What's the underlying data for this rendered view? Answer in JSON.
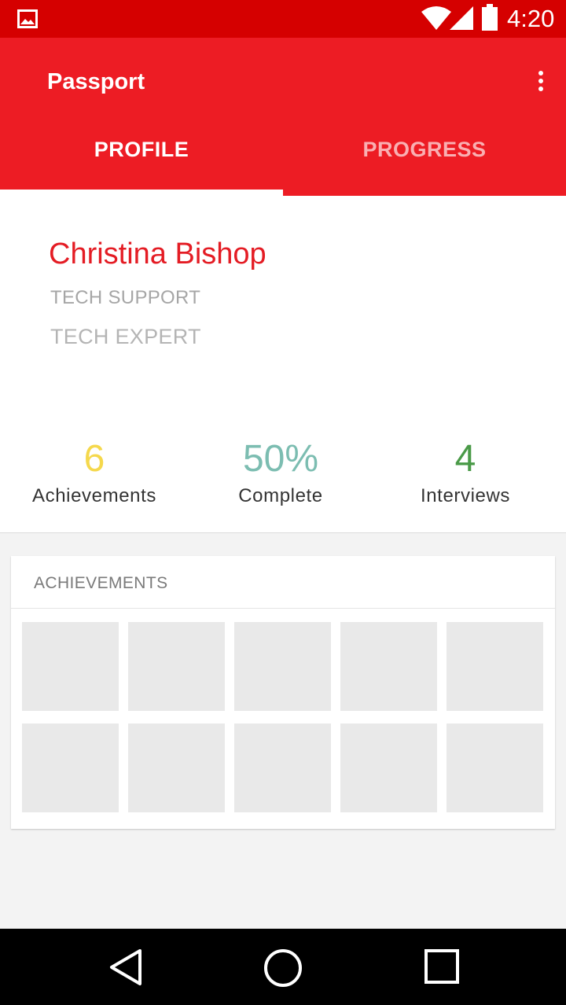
{
  "status_bar": {
    "time": "4:20",
    "icons": [
      "image-notification-icon",
      "wifi-icon",
      "cell-signal-icon",
      "battery-icon"
    ],
    "background": "#d50000"
  },
  "app_bar": {
    "title": "Passport",
    "background": "#ed1c24",
    "tabs": [
      {
        "label": "PROFILE",
        "selected": true
      },
      {
        "label": "PROGRESS",
        "selected": false
      }
    ]
  },
  "profile": {
    "name": "Christina Bishop",
    "roles": [
      "TECH SUPPORT",
      "TECH EXPERT"
    ],
    "stats": [
      {
        "value": "6",
        "label": "Achievements",
        "color": "#f5d84c"
      },
      {
        "value": "50%",
        "label": "Complete",
        "color": "#7cbdb1"
      },
      {
        "value": "4",
        "label": "Interviews",
        "color": "#4a9a48"
      }
    ]
  },
  "achievements": {
    "header": "ACHIEVEMENTS",
    "tile_count": 10
  },
  "nav_bar": {
    "buttons": [
      "back-icon",
      "home-icon",
      "recents-icon"
    ]
  }
}
